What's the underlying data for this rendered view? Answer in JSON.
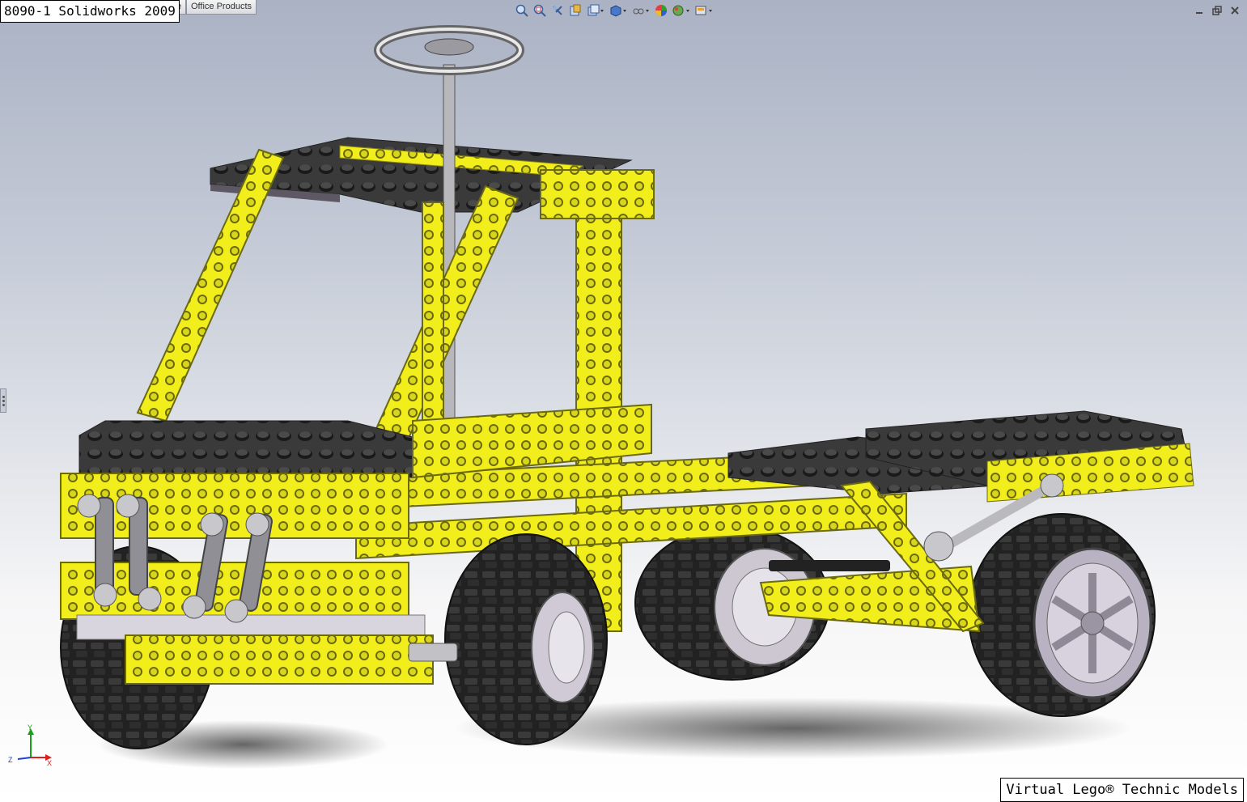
{
  "window": {
    "title_label": "8090-1 Solidworks 2009"
  },
  "tabs": [
    {
      "label": "e"
    },
    {
      "label": "Office Products"
    }
  ],
  "hud_toolbar": {
    "buttons": [
      {
        "icon": "zoom-to-fit-icon"
      },
      {
        "icon": "zoom-to-area-icon"
      },
      {
        "icon": "previous-view-icon"
      },
      {
        "icon": "section-view-icon"
      },
      {
        "icon": "view-orientation-icon"
      },
      {
        "icon": "display-style-icon"
      },
      {
        "icon": "hide-show-items-icon"
      },
      {
        "icon": "edit-appearance-icon"
      },
      {
        "icon": "apply-scene-icon"
      },
      {
        "icon": "view-settings-icon"
      }
    ]
  },
  "triad": {
    "x": "X",
    "y": "Y",
    "z": "Z"
  },
  "watermark": "Virtual Lego® Technic Models",
  "colors": {
    "lego_yellow": "#f2ee1c",
    "lego_black": "#2b2b2b",
    "tire": "#1d1d1d",
    "rim": "#c9c3d0",
    "accent_axis_x": "#e02020",
    "accent_axis_y": "#18a018",
    "accent_axis_z": "#2040d0"
  }
}
